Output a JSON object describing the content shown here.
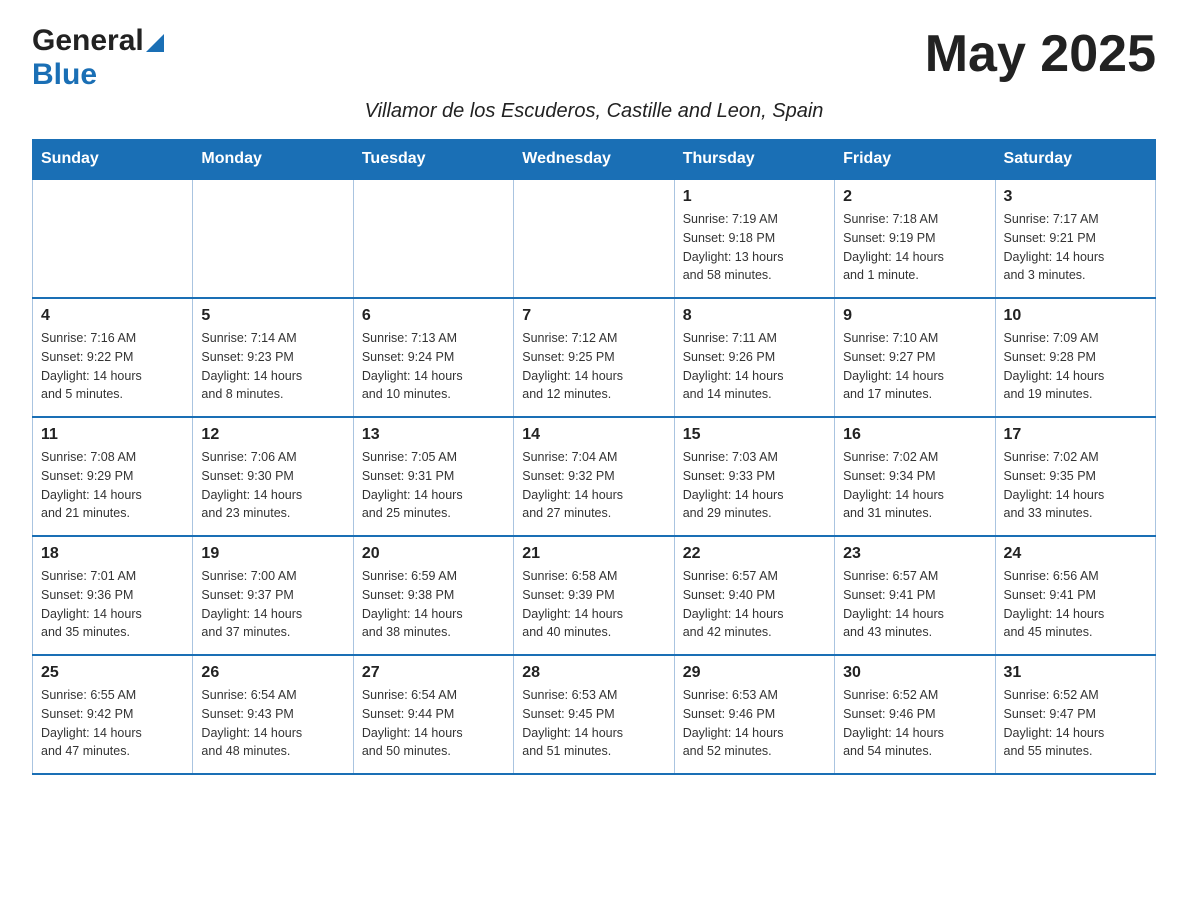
{
  "header": {
    "logo_general": "General",
    "logo_blue": "Blue",
    "month_title": "May 2025",
    "subtitle": "Villamor de los Escuderos, Castille and Leon, Spain"
  },
  "days_of_week": [
    "Sunday",
    "Monday",
    "Tuesday",
    "Wednesday",
    "Thursday",
    "Friday",
    "Saturday"
  ],
  "weeks": [
    [
      {
        "day": "",
        "info": ""
      },
      {
        "day": "",
        "info": ""
      },
      {
        "day": "",
        "info": ""
      },
      {
        "day": "",
        "info": ""
      },
      {
        "day": "1",
        "info": "Sunrise: 7:19 AM\nSunset: 9:18 PM\nDaylight: 13 hours\nand 58 minutes."
      },
      {
        "day": "2",
        "info": "Sunrise: 7:18 AM\nSunset: 9:19 PM\nDaylight: 14 hours\nand 1 minute."
      },
      {
        "day": "3",
        "info": "Sunrise: 7:17 AM\nSunset: 9:21 PM\nDaylight: 14 hours\nand 3 minutes."
      }
    ],
    [
      {
        "day": "4",
        "info": "Sunrise: 7:16 AM\nSunset: 9:22 PM\nDaylight: 14 hours\nand 5 minutes."
      },
      {
        "day": "5",
        "info": "Sunrise: 7:14 AM\nSunset: 9:23 PM\nDaylight: 14 hours\nand 8 minutes."
      },
      {
        "day": "6",
        "info": "Sunrise: 7:13 AM\nSunset: 9:24 PM\nDaylight: 14 hours\nand 10 minutes."
      },
      {
        "day": "7",
        "info": "Sunrise: 7:12 AM\nSunset: 9:25 PM\nDaylight: 14 hours\nand 12 minutes."
      },
      {
        "day": "8",
        "info": "Sunrise: 7:11 AM\nSunset: 9:26 PM\nDaylight: 14 hours\nand 14 minutes."
      },
      {
        "day": "9",
        "info": "Sunrise: 7:10 AM\nSunset: 9:27 PM\nDaylight: 14 hours\nand 17 minutes."
      },
      {
        "day": "10",
        "info": "Sunrise: 7:09 AM\nSunset: 9:28 PM\nDaylight: 14 hours\nand 19 minutes."
      }
    ],
    [
      {
        "day": "11",
        "info": "Sunrise: 7:08 AM\nSunset: 9:29 PM\nDaylight: 14 hours\nand 21 minutes."
      },
      {
        "day": "12",
        "info": "Sunrise: 7:06 AM\nSunset: 9:30 PM\nDaylight: 14 hours\nand 23 minutes."
      },
      {
        "day": "13",
        "info": "Sunrise: 7:05 AM\nSunset: 9:31 PM\nDaylight: 14 hours\nand 25 minutes."
      },
      {
        "day": "14",
        "info": "Sunrise: 7:04 AM\nSunset: 9:32 PM\nDaylight: 14 hours\nand 27 minutes."
      },
      {
        "day": "15",
        "info": "Sunrise: 7:03 AM\nSunset: 9:33 PM\nDaylight: 14 hours\nand 29 minutes."
      },
      {
        "day": "16",
        "info": "Sunrise: 7:02 AM\nSunset: 9:34 PM\nDaylight: 14 hours\nand 31 minutes."
      },
      {
        "day": "17",
        "info": "Sunrise: 7:02 AM\nSunset: 9:35 PM\nDaylight: 14 hours\nand 33 minutes."
      }
    ],
    [
      {
        "day": "18",
        "info": "Sunrise: 7:01 AM\nSunset: 9:36 PM\nDaylight: 14 hours\nand 35 minutes."
      },
      {
        "day": "19",
        "info": "Sunrise: 7:00 AM\nSunset: 9:37 PM\nDaylight: 14 hours\nand 37 minutes."
      },
      {
        "day": "20",
        "info": "Sunrise: 6:59 AM\nSunset: 9:38 PM\nDaylight: 14 hours\nand 38 minutes."
      },
      {
        "day": "21",
        "info": "Sunrise: 6:58 AM\nSunset: 9:39 PM\nDaylight: 14 hours\nand 40 minutes."
      },
      {
        "day": "22",
        "info": "Sunrise: 6:57 AM\nSunset: 9:40 PM\nDaylight: 14 hours\nand 42 minutes."
      },
      {
        "day": "23",
        "info": "Sunrise: 6:57 AM\nSunset: 9:41 PM\nDaylight: 14 hours\nand 43 minutes."
      },
      {
        "day": "24",
        "info": "Sunrise: 6:56 AM\nSunset: 9:41 PM\nDaylight: 14 hours\nand 45 minutes."
      }
    ],
    [
      {
        "day": "25",
        "info": "Sunrise: 6:55 AM\nSunset: 9:42 PM\nDaylight: 14 hours\nand 47 minutes."
      },
      {
        "day": "26",
        "info": "Sunrise: 6:54 AM\nSunset: 9:43 PM\nDaylight: 14 hours\nand 48 minutes."
      },
      {
        "day": "27",
        "info": "Sunrise: 6:54 AM\nSunset: 9:44 PM\nDaylight: 14 hours\nand 50 minutes."
      },
      {
        "day": "28",
        "info": "Sunrise: 6:53 AM\nSunset: 9:45 PM\nDaylight: 14 hours\nand 51 minutes."
      },
      {
        "day": "29",
        "info": "Sunrise: 6:53 AM\nSunset: 9:46 PM\nDaylight: 14 hours\nand 52 minutes."
      },
      {
        "day": "30",
        "info": "Sunrise: 6:52 AM\nSunset: 9:46 PM\nDaylight: 14 hours\nand 54 minutes."
      },
      {
        "day": "31",
        "info": "Sunrise: 6:52 AM\nSunset: 9:47 PM\nDaylight: 14 hours\nand 55 minutes."
      }
    ]
  ]
}
